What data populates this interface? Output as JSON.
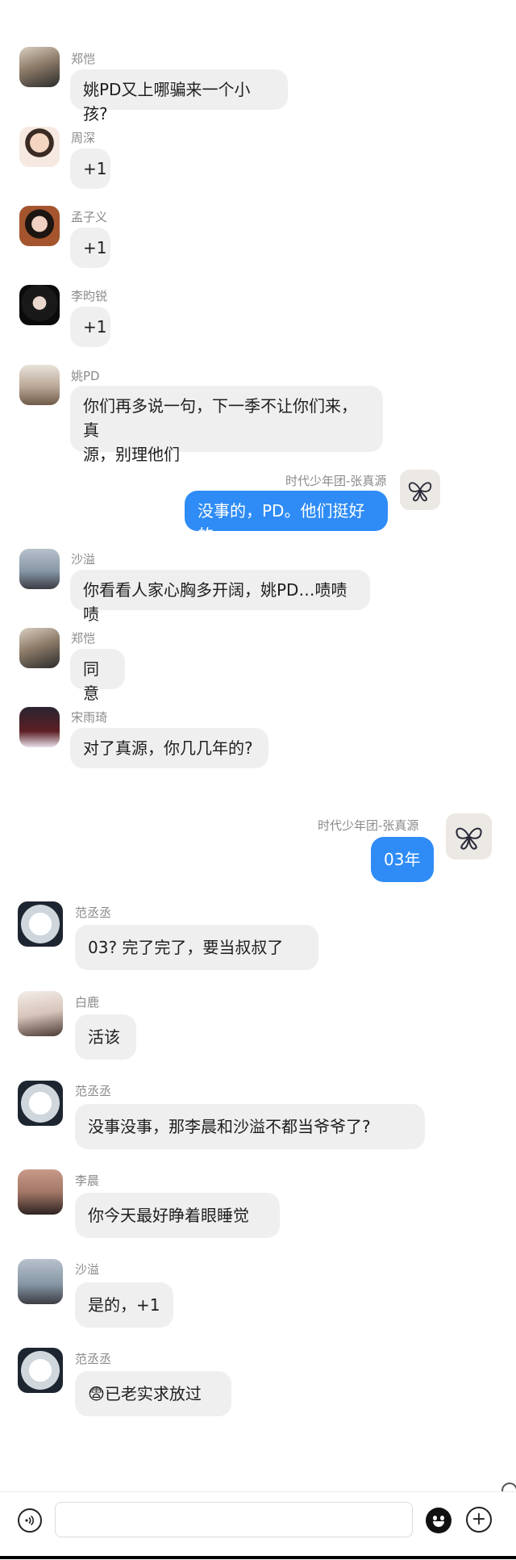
{
  "messages": [
    {
      "sender": "郑恺",
      "text": "姚PD又上哪骗来一个小孩?",
      "outgoing": false
    },
    {
      "sender": "周深",
      "text": "+1",
      "outgoing": false
    },
    {
      "sender": "孟子义",
      "text": "+1",
      "outgoing": false
    },
    {
      "sender": "李昀锐",
      "text": "+1",
      "outgoing": false
    },
    {
      "sender": "姚PD",
      "text_line1": "你们再多说一句，下一季不让你们来，真",
      "text_line2": "源，别理他们",
      "outgoing": false
    },
    {
      "sender": "时代少年团-张真源",
      "text": "没事的，PD。他们挺好的",
      "outgoing": true
    },
    {
      "sender": "沙溢",
      "text": "你看看人家心胸多开阔，姚PD…啧啧啧",
      "outgoing": false
    },
    {
      "sender": "郑恺",
      "text": "同意",
      "outgoing": false
    },
    {
      "sender": "宋雨琦",
      "text": "对了真源，你几几年的?",
      "outgoing": false
    },
    {
      "sender": "时代少年团-张真源",
      "text": "03年",
      "outgoing": true
    },
    {
      "sender": "范丞丞",
      "text": "03? 完了完了，要当叔叔了",
      "outgoing": false
    },
    {
      "sender": "白鹿",
      "text": "活该",
      "outgoing": false
    },
    {
      "sender": "范丞丞",
      "text": "没事没事，那李晨和沙溢不都当爷爷了?",
      "outgoing": false
    },
    {
      "sender": "李晨",
      "text": "你今天最好睁着眼睡觉",
      "outgoing": false
    },
    {
      "sender": "沙溢",
      "text": "是的，+1",
      "outgoing": false
    },
    {
      "sender": "范丞丞",
      "text": "😨已老实求放过",
      "outgoing": false
    }
  ],
  "input_bar": {
    "message_field_value": "",
    "voice_icon": "voice-icon",
    "emoji_icon": "emoji-icon",
    "add_icon": "plus-icon"
  },
  "colors": {
    "outgoing_bubble": "#2f8cf6",
    "incoming_bubble": "#efefef",
    "sender_name": "#8a8a8a"
  }
}
